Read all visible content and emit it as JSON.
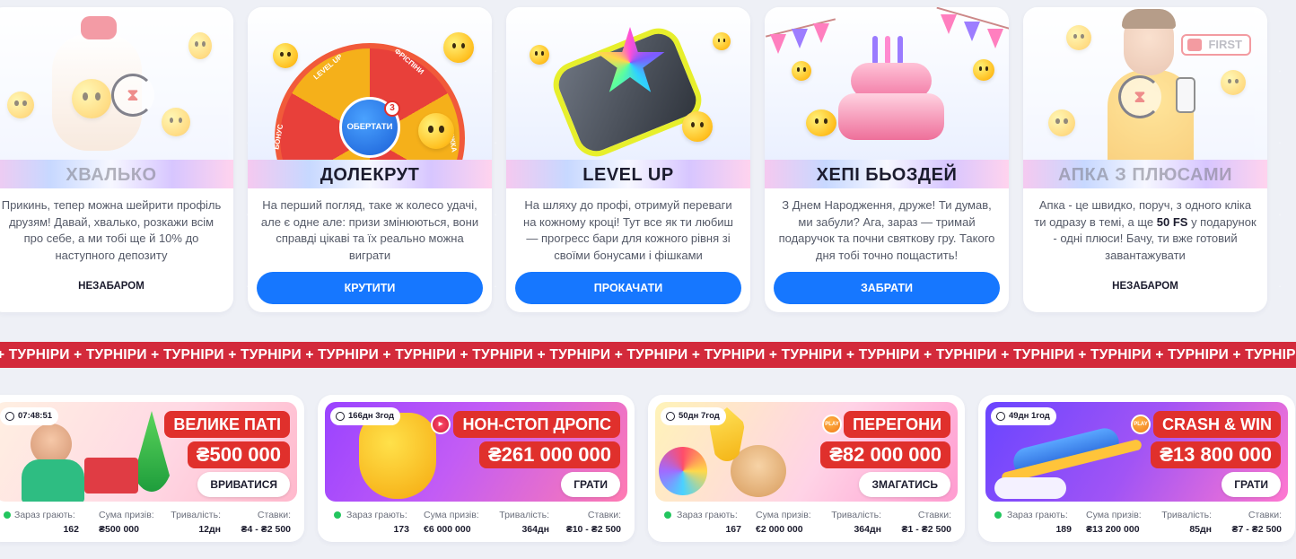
{
  "promos": [
    {
      "title": "ХВАЛЬКО",
      "desc": "Прикинь, тепер можна шейрити профіль друзям! Давай, хвалько, розкажи всім про себе, а ми тобі ще й 10% до наступного депозиту",
      "action": "НЕЗАБАРОМ",
      "state": "soon",
      "icon": "hand-medal-timer-icon"
    },
    {
      "title": "ДОЛЕКРУТ",
      "desc": "На перший погляд, таке ж колесо удачі, але є одне але: призи змінюються, вони справді цікаві та їх реально можна виграти",
      "action": "КРУТИТИ",
      "state": "active",
      "icon": "prize-wheel-icon",
      "wheel": {
        "center": "ОБЕРТАТИ",
        "badge": "3",
        "segments": [
          "LEVEL UP",
          "ФРІСПІНИ",
          "БОНУС",
          "ЗНИЖКА"
        ]
      }
    },
    {
      "title": "LEVEL UP",
      "desc": "На шляху до профі, отримуй переваги на кожному кроці! Тут все як ти любиш — прогресс бари для кожного рівня зі своїми бонусами і фішками",
      "action": "ПРОКАЧАТИ",
      "state": "active",
      "icon": "level-gem-icon"
    },
    {
      "title": "ХЕПІ БЬОЗДЕЙ",
      "desc": "З Днем Народження, друже! Ти думав, ми забули? Ага, зараз — тримай подаручок та почни святкову гру. Такого дня тобі точно пощастить!",
      "action": "ЗАБРАТИ",
      "state": "active",
      "icon": "birthday-cake-icon"
    },
    {
      "title": "АПКА З ПЛЮСАМИ",
      "desc_before": "Апка - це швидко, поруч, з одного кліка ти одразу в темі, а ще ",
      "desc_bold": "50 FS",
      "desc_after": " у подарунок - одні плюси! Бачу, ти вже готовий завантажувати",
      "action": "НЕЗАБАРОМ",
      "state": "soon",
      "icon": "man-phone-timer-icon",
      "tag": "FIRST"
    }
  ],
  "ticker": {
    "text": "+ ТУРНІРИ + ТУРНІРИ + ТУРНІРИ + ТУРНІРИ + ТУРНІРИ + ТУРНІРИ + ТУРНІРИ + ТУРНІРИ + ТУРНІРИ + ТУРНІРИ + ТУРНІРИ + ТУРНІРИ + ТУРНІРИ + ТУРНІРИ + ТУРНІРИ + ТУРНІРИ + ТУРНІРИ +"
  },
  "stat_labels": {
    "players": "Зараз грають:",
    "prize": "Сума призів:",
    "duration": "Тривалість:",
    "bets": "Ставки:"
  },
  "tournaments": [
    {
      "timer": "07:48:51",
      "name": "ВЕЛИКЕ ПАТІ",
      "prize": "₴500 000",
      "button": "ВРИВАТИСЯ",
      "players": "162",
      "prize_sum": "₴500 000",
      "duration": "12дн",
      "bets": "₴4 - ₴2 500",
      "colors": [
        "#ffe3c9",
        "#ffb3c7"
      ]
    },
    {
      "timer": "166дн 3год",
      "name": "НОН-СТОП ДРОПС",
      "prize": "₴261 000 000",
      "button": "ГРАТИ",
      "players": "173",
      "prize_sum": "€6 000 000",
      "duration": "364дн",
      "bets": "₴10 - ₴2 500",
      "colors": [
        "#a24cff",
        "#ff6aa8"
      ]
    },
    {
      "timer": "50дн 7год",
      "name": "ПЕРЕГОНИ",
      "prize": "₴82 000 000",
      "button": "ЗМАГАТИСЬ",
      "players": "167",
      "prize_sum": "€2 000 000",
      "duration": "364дн",
      "bets": "₴1 - ₴2 500",
      "colors": [
        "#ffe8a3",
        "#ff9ed0"
      ]
    },
    {
      "timer": "49дн 1год",
      "name": "CRASH & WIN",
      "prize": "₴13 800 000",
      "button": "ГРАТИ",
      "players": "189",
      "prize_sum": "₴13 200 000",
      "duration": "85дн",
      "bets": "₴7 - ₴2 500",
      "colors": [
        "#7a4dff",
        "#ff6fd0"
      ]
    }
  ]
}
